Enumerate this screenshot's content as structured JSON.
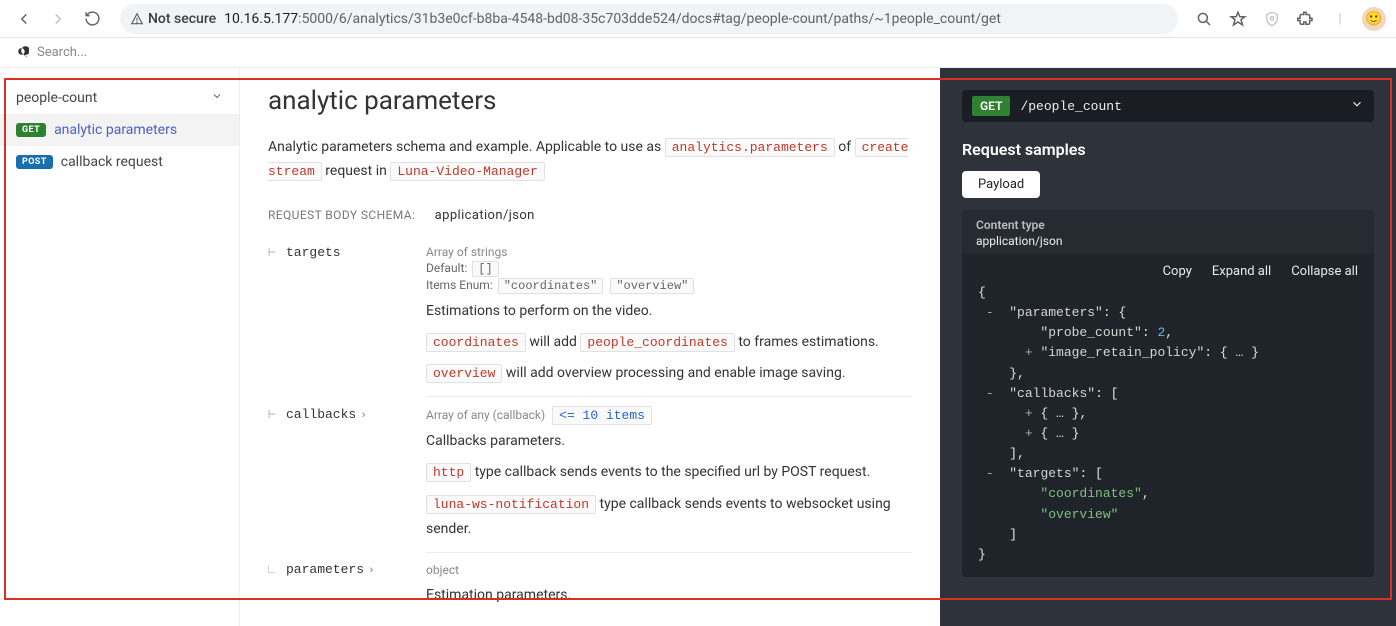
{
  "chrome": {
    "not_secure": "Not secure",
    "url_host": "10.16.5.177",
    "url_port": ":5000",
    "url_pre": "/6/analytics/",
    "url_uuid": "31b3e0cf-b8ba-4548-bd08-35c703dde524",
    "url_post": "/docs#tag/people-count/paths/~1people_count/get"
  },
  "search": {
    "placeholder": "Search..."
  },
  "sidebar": {
    "tag": "people-count",
    "items": [
      {
        "method": "GET",
        "label": "analytic parameters"
      },
      {
        "method": "POST",
        "label": "callback request"
      }
    ]
  },
  "main": {
    "title": "analytic parameters",
    "desc1": "Analytic parameters schema and example. Applicable to use as",
    "chip1": "analytics.parameters",
    "of": "of",
    "chip2": "create stream",
    "desc2": "request in",
    "chip3": "Luna-Video-Manager",
    "schema_label": "REQUEST BODY SCHEMA:",
    "schema_mime": "application/json",
    "props": {
      "targets": {
        "name": "targets",
        "type": "Array of strings",
        "default_label": "Default:",
        "default_val": "[]",
        "enum_label": "Items Enum:",
        "enum1": "\"coordinates\"",
        "enum2": "\"overview\"",
        "d1": "Estimations to perform on the video.",
        "c1": "coordinates",
        "d2a": "will add",
        "c2": "people_coordinates",
        "d2b": "to frames estimations.",
        "c3": "overview",
        "d3": "will add overview processing and enable image saving."
      },
      "callbacks": {
        "name": "callbacks",
        "type": "Array of any (callback)",
        "constraint": "<= 10 items",
        "d1": "Callbacks parameters.",
        "c1": "http",
        "d2": "type callback sends events to the specified url by POST request.",
        "c2": "luna-ws-notification",
        "d3": "type callback sends events to websocket using sender."
      },
      "parameters": {
        "name": "parameters",
        "type": "object",
        "d1": "Estimation parameters."
      }
    }
  },
  "right": {
    "method": "GET",
    "path": "/people_count",
    "samples_h": "Request samples",
    "tab": "Payload",
    "ct_label": "Content type",
    "ct_val": "application/json",
    "tool_copy": "Copy",
    "tool_expand": "Expand all",
    "tool_collapse": "Collapse all",
    "json": {
      "k_parameters": "\"parameters\"",
      "k_probe": "\"probe_count\"",
      "v_probe": "2",
      "k_retain": "\"image_retain_policy\"",
      "k_callbacks": "\"callbacks\"",
      "k_targets": "\"targets\"",
      "v_t1": "\"coordinates\"",
      "v_t2": "\"overview\""
    }
  }
}
